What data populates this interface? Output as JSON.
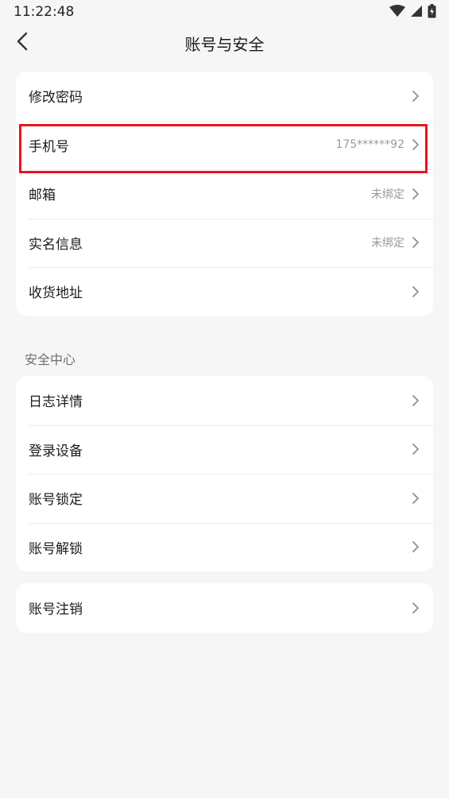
{
  "status": {
    "time": "11:22:48"
  },
  "nav": {
    "title": "账号与安全"
  },
  "account_group": [
    {
      "label": "修改密码",
      "value": ""
    },
    {
      "label": "手机号",
      "value": "175******92"
    },
    {
      "label": "邮箱",
      "value": "未绑定"
    },
    {
      "label": "实名信息",
      "value": "未绑定"
    },
    {
      "label": "收货地址",
      "value": ""
    }
  ],
  "security_section": {
    "title": "安全中心",
    "items": [
      {
        "label": "日志详情"
      },
      {
        "label": "登录设备"
      },
      {
        "label": "账号锁定"
      },
      {
        "label": "账号解锁"
      }
    ]
  },
  "deregister": {
    "label": "账号注销"
  },
  "colors": {
    "highlight": "#e8141b",
    "background": "#f6f6f7"
  }
}
